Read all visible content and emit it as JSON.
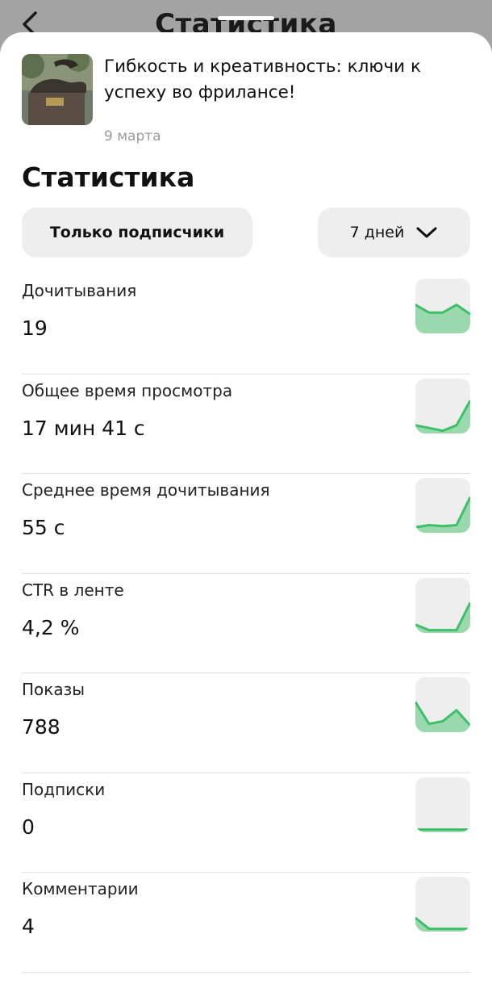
{
  "header": {
    "title": "Статистика"
  },
  "post": {
    "title": "Гибкость и креативность: ключи к успеху во фрилансе!",
    "date": "9 марта"
  },
  "sheet": {
    "title": "Статистика"
  },
  "filters": {
    "audience": "Только подписчики",
    "period": "7 дней"
  },
  "colors": {
    "accent": "#3fbf6a",
    "fill": "#9ad9ad",
    "card": "#eeeeee"
  },
  "metrics": [
    {
      "label": "Дочитывания",
      "value": "19",
      "trend": [
        0.52,
        0.38,
        0.38,
        0.52,
        0.35
      ]
    },
    {
      "label": "Общее время просмотра",
      "value": "17 мин 41 с",
      "trend": [
        0.15,
        0.1,
        0.05,
        0.15,
        0.6
      ]
    },
    {
      "label": "Среднее время дочитывания",
      "value": "55 с",
      "trend": [
        0.1,
        0.14,
        0.12,
        0.14,
        0.65
      ]
    },
    {
      "label": "CTR в ленте",
      "value": "4,2 %",
      "trend": [
        0.15,
        0.05,
        0.05,
        0.05,
        0.55
      ]
    },
    {
      "label": "Показы",
      "value": "788",
      "trend": [
        0.55,
        0.15,
        0.2,
        0.4,
        0.12
      ]
    },
    {
      "label": "Подписки",
      "value": "0",
      "trend": [
        0.05,
        0.05,
        0.05,
        0.05,
        0.05
      ]
    },
    {
      "label": "Комментарии",
      "value": "4",
      "trend": [
        0.25,
        0.05,
        0.05,
        0.05,
        0.05
      ]
    }
  ]
}
